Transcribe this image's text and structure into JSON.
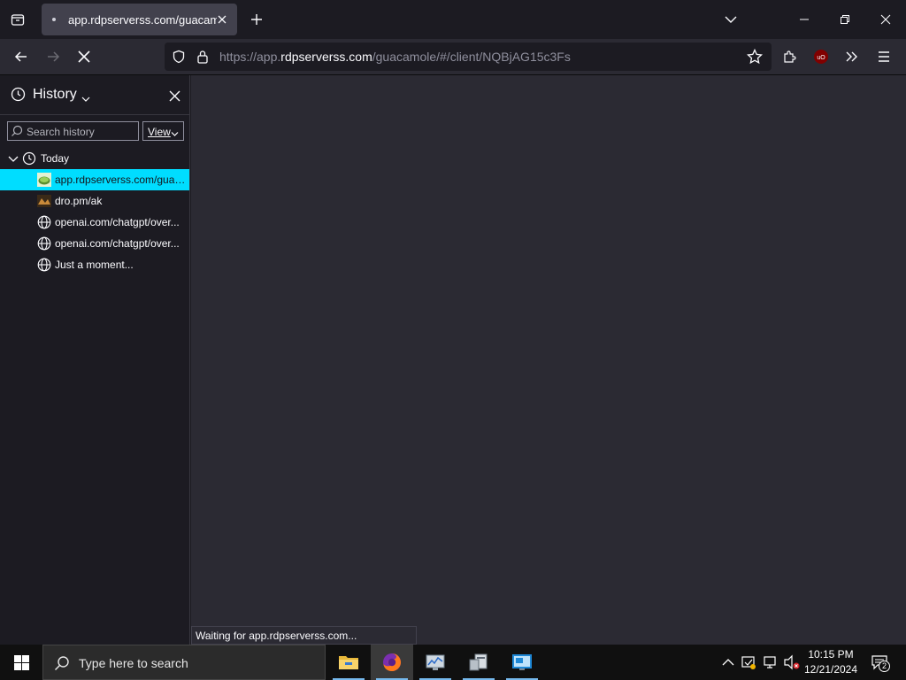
{
  "tab": {
    "title": "app.rdpserverss.com/guacamole"
  },
  "url": {
    "prefix": "https://app.",
    "host": "rdpserverss.com",
    "path": "/guacamole/#/client/NQBjAG15c3Fs"
  },
  "sidebar": {
    "title": "History",
    "search_placeholder": "Search history",
    "view_label": "View",
    "group_label": "Today",
    "items": [
      {
        "label": "app.rdpserverss.com/guac...",
        "icon": "guacamole-favicon"
      },
      {
        "label": "dro.pm/ak",
        "icon": "dro-favicon"
      },
      {
        "label": "openai.com/chatgpt/over...",
        "icon": "globe-icon"
      },
      {
        "label": "openai.com/chatgpt/over...",
        "icon": "globe-icon"
      },
      {
        "label": "Just a moment...",
        "icon": "globe-icon"
      }
    ]
  },
  "status": {
    "text": "Waiting for app.rdpserverss.com..."
  },
  "taskbar": {
    "search_placeholder": "Type here to search",
    "time": "10:15 PM",
    "date": "12/21/2024",
    "notification_count": "2"
  },
  "colors": {
    "accent": "#00ddff",
    "background": "#1c1b22",
    "toolbar": "#2b2a33"
  }
}
